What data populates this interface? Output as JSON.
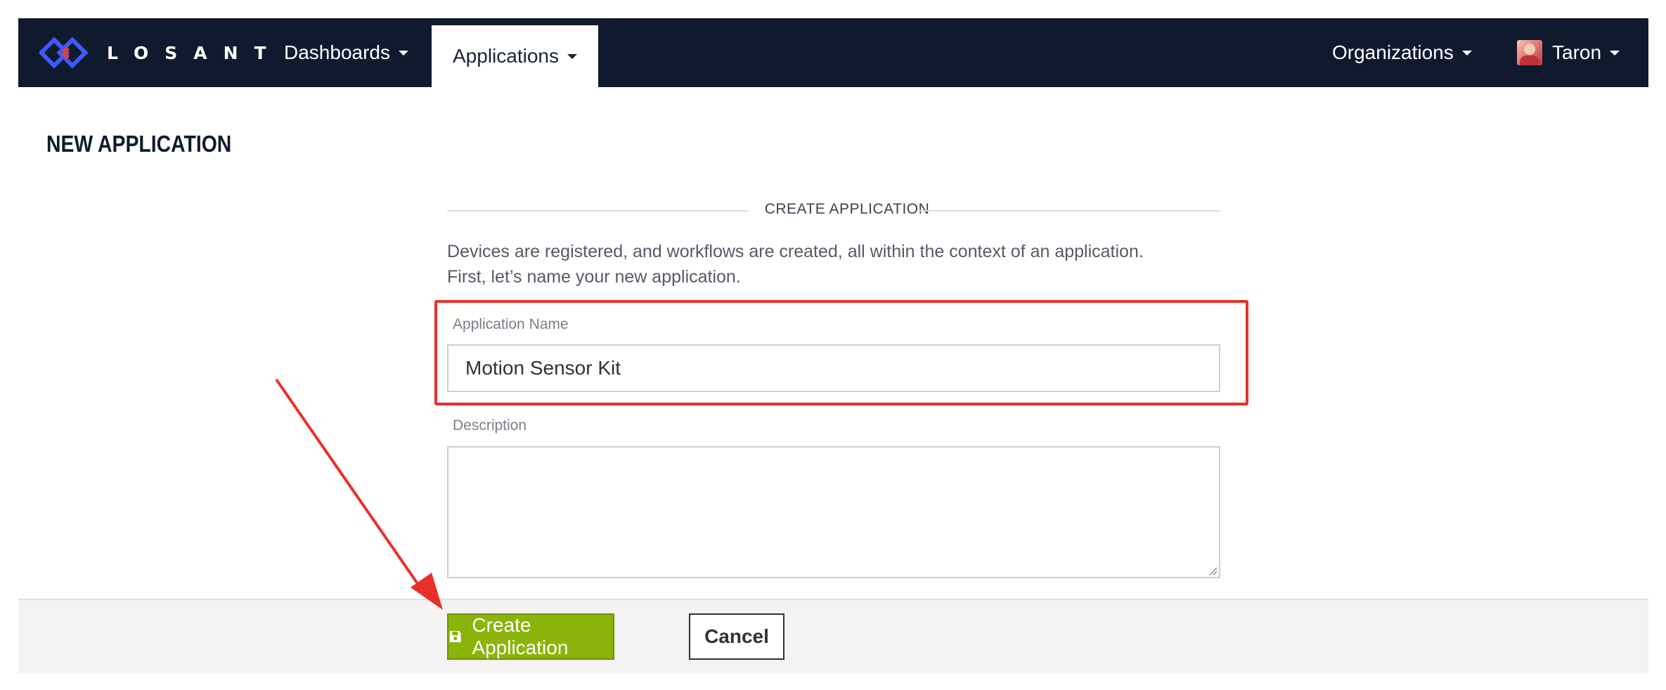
{
  "brand": {
    "name": "LOSANT"
  },
  "nav": {
    "dashboards": "Dashboards",
    "applications": "Applications",
    "organizations": "Organizations",
    "user": "Taron"
  },
  "page": {
    "title": "NEW APPLICATION"
  },
  "form": {
    "section_heading": "CREATE APPLICATION",
    "intro_line1": "Devices are registered, and workflows are created, all within the context of an application.",
    "intro_line2": "First, let’s name your new application.",
    "name_label": "Application Name",
    "name_value": "Motion Sensor Kit",
    "description_label": "Description",
    "description_value": ""
  },
  "actions": {
    "create_label": "Create Application",
    "cancel_label": "Cancel"
  },
  "colors": {
    "navbar": "#101a2f",
    "primary_button": "#8ab40a",
    "annotation": "#e8302a",
    "logo_blue": "#3d5afe",
    "logo_red": "#e8402f"
  },
  "icons": {
    "logo": "losant-logo-icon",
    "caret": "caret-down-icon",
    "save": "save-icon"
  }
}
